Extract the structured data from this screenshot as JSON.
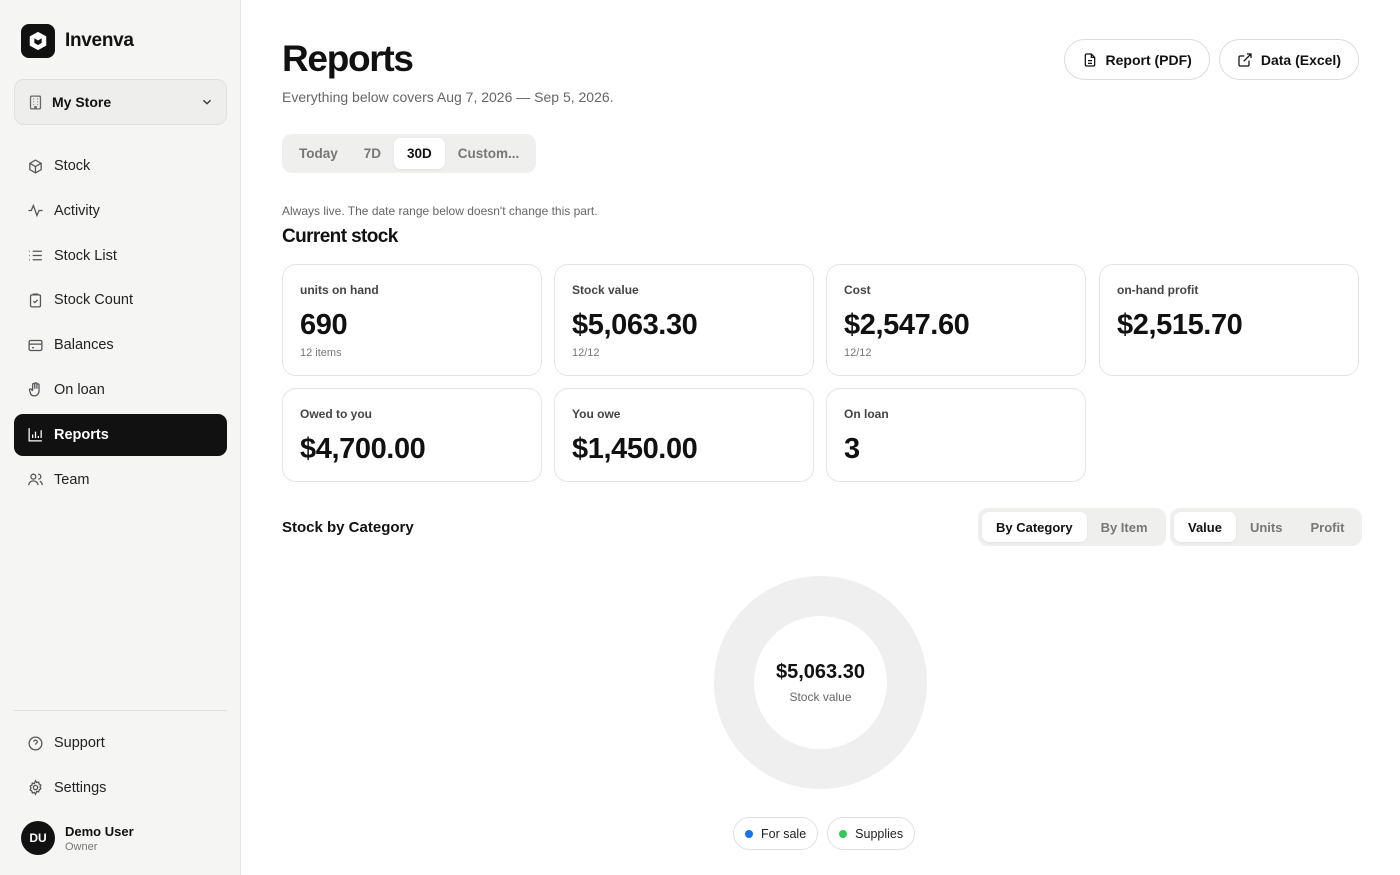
{
  "app": {
    "name": "Invenva"
  },
  "store_select": {
    "label": "My Store",
    "icon": "building-icon"
  },
  "nav": {
    "items": [
      {
        "label": "Stock",
        "icon": "box-icon"
      },
      {
        "label": "Activity",
        "icon": "activity-icon"
      },
      {
        "label": "Stock List",
        "icon": "list-icon"
      },
      {
        "label": "Stock Count",
        "icon": "clipboard-check-icon"
      },
      {
        "label": "Balances",
        "icon": "credit-card-icon"
      },
      {
        "label": "On loan",
        "icon": "hand-icon"
      },
      {
        "label": "Reports",
        "icon": "bar-chart-icon",
        "active": true
      },
      {
        "label": "Team",
        "icon": "users-icon"
      }
    ],
    "bottom": [
      {
        "label": "Support",
        "icon": "help-circle-icon"
      },
      {
        "label": "Settings",
        "icon": "gear-icon"
      }
    ]
  },
  "user": {
    "initials": "DU",
    "name": "Demo User",
    "role": "Owner"
  },
  "header": {
    "title": "Reports",
    "subtitle": "Everything below covers Aug 7, 2026 — Sep 5, 2026.",
    "actions": [
      {
        "label": "Report (PDF)",
        "icon": "file-icon"
      },
      {
        "label": "Data (Excel)",
        "icon": "external-link-icon"
      }
    ]
  },
  "range_tabs": {
    "items": [
      "Today",
      "7D",
      "30D",
      "Custom..."
    ],
    "active": "30D"
  },
  "current_stock": {
    "note": "Always live. The date range below doesn't change this part.",
    "title": "Current stock",
    "cards": [
      {
        "label": "units on hand",
        "value": "690",
        "sub": "12 items"
      },
      {
        "label": "Stock value",
        "value": "$5,063.30",
        "sub": "12/12"
      },
      {
        "label": "Cost",
        "value": "$2,547.60",
        "sub": "12/12"
      },
      {
        "label": "on-hand profit",
        "value": "$2,515.70",
        "sub": ""
      },
      {
        "label": "Owed to you",
        "value": "$4,700.00",
        "sub": ""
      },
      {
        "label": "You owe",
        "value": "$1,450.00",
        "sub": ""
      },
      {
        "label": "On loan",
        "value": "3",
        "sub": ""
      }
    ]
  },
  "stock_chart": {
    "title": "Stock by Category",
    "group_tabs": {
      "items": [
        "By Category",
        "By Item"
      ],
      "active": "By Category"
    },
    "metric_tabs": {
      "items": [
        "Value",
        "Units",
        "Profit"
      ],
      "active": "Value"
    },
    "center_value": "$5,063.30",
    "center_label": "Stock value",
    "legend": [
      {
        "label": "For sale",
        "color": "#1a73e8"
      },
      {
        "label": "Supplies",
        "color": "#34c759"
      }
    ],
    "ring_color": "#efefef"
  },
  "colors": {
    "accent": "#111111",
    "sidebar_bg": "#f5f5f4"
  }
}
